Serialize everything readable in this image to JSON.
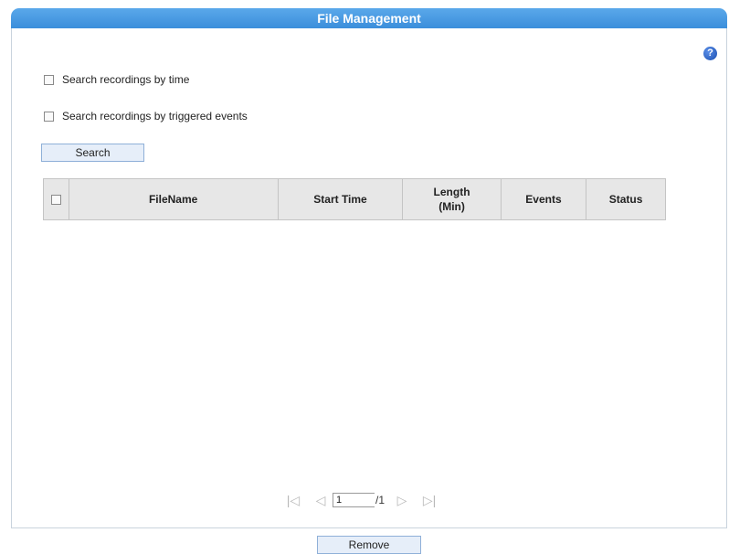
{
  "header": {
    "title": "File Management"
  },
  "help": {
    "icon": "help-icon",
    "glyph": "?"
  },
  "options": [
    {
      "label": "Search recordings by time",
      "checked": false
    },
    {
      "label": "Search recordings by triggered events",
      "checked": false
    }
  ],
  "search_button": "Search",
  "table": {
    "columns": [
      "FileName",
      "Start Time",
      "Length (Min)",
      "Events",
      "Status"
    ],
    "rows": []
  },
  "pager": {
    "first": "|◁",
    "prev": "◁",
    "current": "1",
    "total": "/1",
    "next": "▷",
    "last": "▷|"
  },
  "remove_button": "Remove",
  "colors": {
    "header": "#3b8edb",
    "button_bg": "#e6eef9",
    "button_border": "#8fb0d8"
  }
}
